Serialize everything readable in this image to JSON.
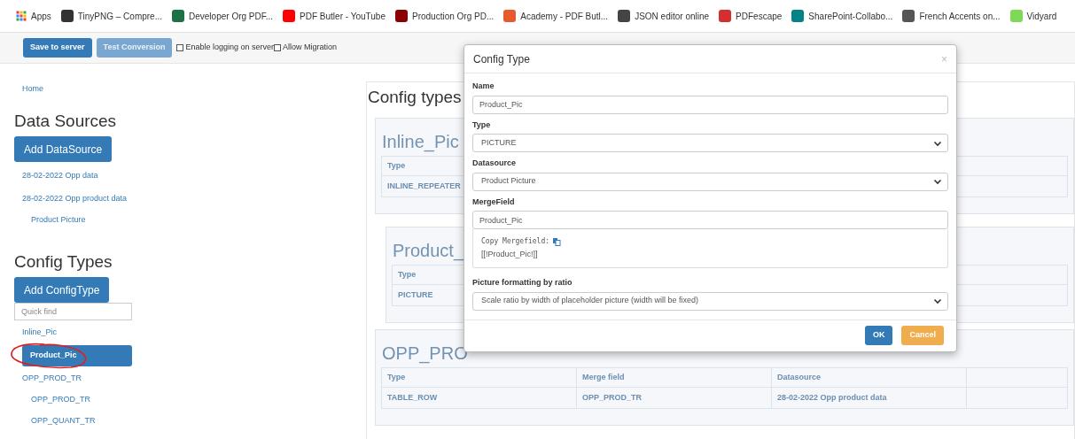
{
  "bookmarks": [
    {
      "kind": "apps",
      "label": "Apps"
    },
    {
      "kind": "site",
      "label": "TinyPNG – Compre...",
      "color": "#333333"
    },
    {
      "kind": "site",
      "label": "Developer Org PDF...",
      "color": "#1e7145"
    },
    {
      "kind": "site",
      "label": "PDF Butler - YouTube",
      "color": "#ff0000"
    },
    {
      "kind": "site",
      "label": "Production Org PD...",
      "color": "#8b0000"
    },
    {
      "kind": "site",
      "label": "Academy - PDF Butl...",
      "color": "#e55b2e"
    },
    {
      "kind": "site",
      "label": "JSON editor online",
      "color": "#444444"
    },
    {
      "kind": "site",
      "label": "PDFescape",
      "color": "#d32f2f"
    },
    {
      "kind": "site",
      "label": "SharePoint-Collabo...",
      "color": "#038387"
    },
    {
      "kind": "site",
      "label": "French Accents on...",
      "color": "#555555"
    },
    {
      "kind": "site",
      "label": "Vidyard",
      "color": "#7ed957"
    }
  ],
  "toolbar": {
    "buttons": [
      {
        "label": "Save to server",
        "disabled": false
      },
      {
        "label": "Test Conversion",
        "disabled": true
      }
    ],
    "options": [
      {
        "label": "Enable logging on server",
        "checked": false
      },
      {
        "label": "Allow Migration",
        "checked": false
      }
    ]
  },
  "sidebar": {
    "breadcrumb": "Home",
    "data_sources": {
      "title": "Data Sources",
      "add_button": "Add DataSource",
      "items": [
        {
          "label": "28-02-2022 Opp data"
        },
        {
          "label": "28-02-2022 Opp product data",
          "children": [
            {
              "label": "Product Picture"
            }
          ]
        }
      ]
    },
    "config_types": {
      "title": "Config Types",
      "add_button": "Add ConfigType",
      "search": {
        "placeholder": "Quick find"
      },
      "items": [
        {
          "label": "Inline_Pic",
          "selected": false
        },
        {
          "label": "Product_Pic",
          "selected": true
        },
        {
          "label": "OPP_PROD_TR",
          "selected": false,
          "children": [
            {
              "label": "OPP_PROD_TR",
              "selected": false
            },
            {
              "label": "OPP_QUANT_TR",
              "selected": false
            }
          ]
        }
      ]
    }
  },
  "main": {
    "title": "Config types",
    "cards": [
      {
        "title": "Inline_Pic",
        "columns": [
          "Type"
        ],
        "rows": [
          [
            "INLINE_REPEATER"
          ]
        ],
        "children": [
          {
            "title": "Product_",
            "columns": [
              "Type"
            ],
            "rows": [
              [
                "PICTURE"
              ]
            ]
          }
        ]
      },
      {
        "title": "OPP_PRO",
        "columns": [
          "Type",
          "Merge field",
          "Datasource"
        ],
        "rows": [
          [
            "TABLE_ROW",
            "OPP_PROD_TR",
            "28-02-2022 Opp product data"
          ]
        ]
      }
    ]
  },
  "dialog": {
    "title": "Config Type",
    "close": "×",
    "fields": [
      {
        "kind": "input",
        "label": "Name",
        "value": "Product_Pic"
      },
      {
        "kind": "select",
        "label": "Type",
        "value": "PICTURE"
      },
      {
        "kind": "select",
        "label": "Datasource",
        "value": "Product Picture"
      },
      {
        "kind": "input",
        "label": "MergeField",
        "value": "Product_Pic"
      },
      {
        "kind": "info",
        "label": "Copy Mergefield:",
        "value": "[[!Product_Pic!]]"
      },
      {
        "kind": "select",
        "label": "Picture formatting by ratio",
        "value": "Scale ratio by width of placeholder picture (width will be fixed)"
      }
    ],
    "buttons": [
      {
        "kind": "primary",
        "label": "OK"
      },
      {
        "kind": "warning",
        "label": "Cancel"
      }
    ]
  }
}
